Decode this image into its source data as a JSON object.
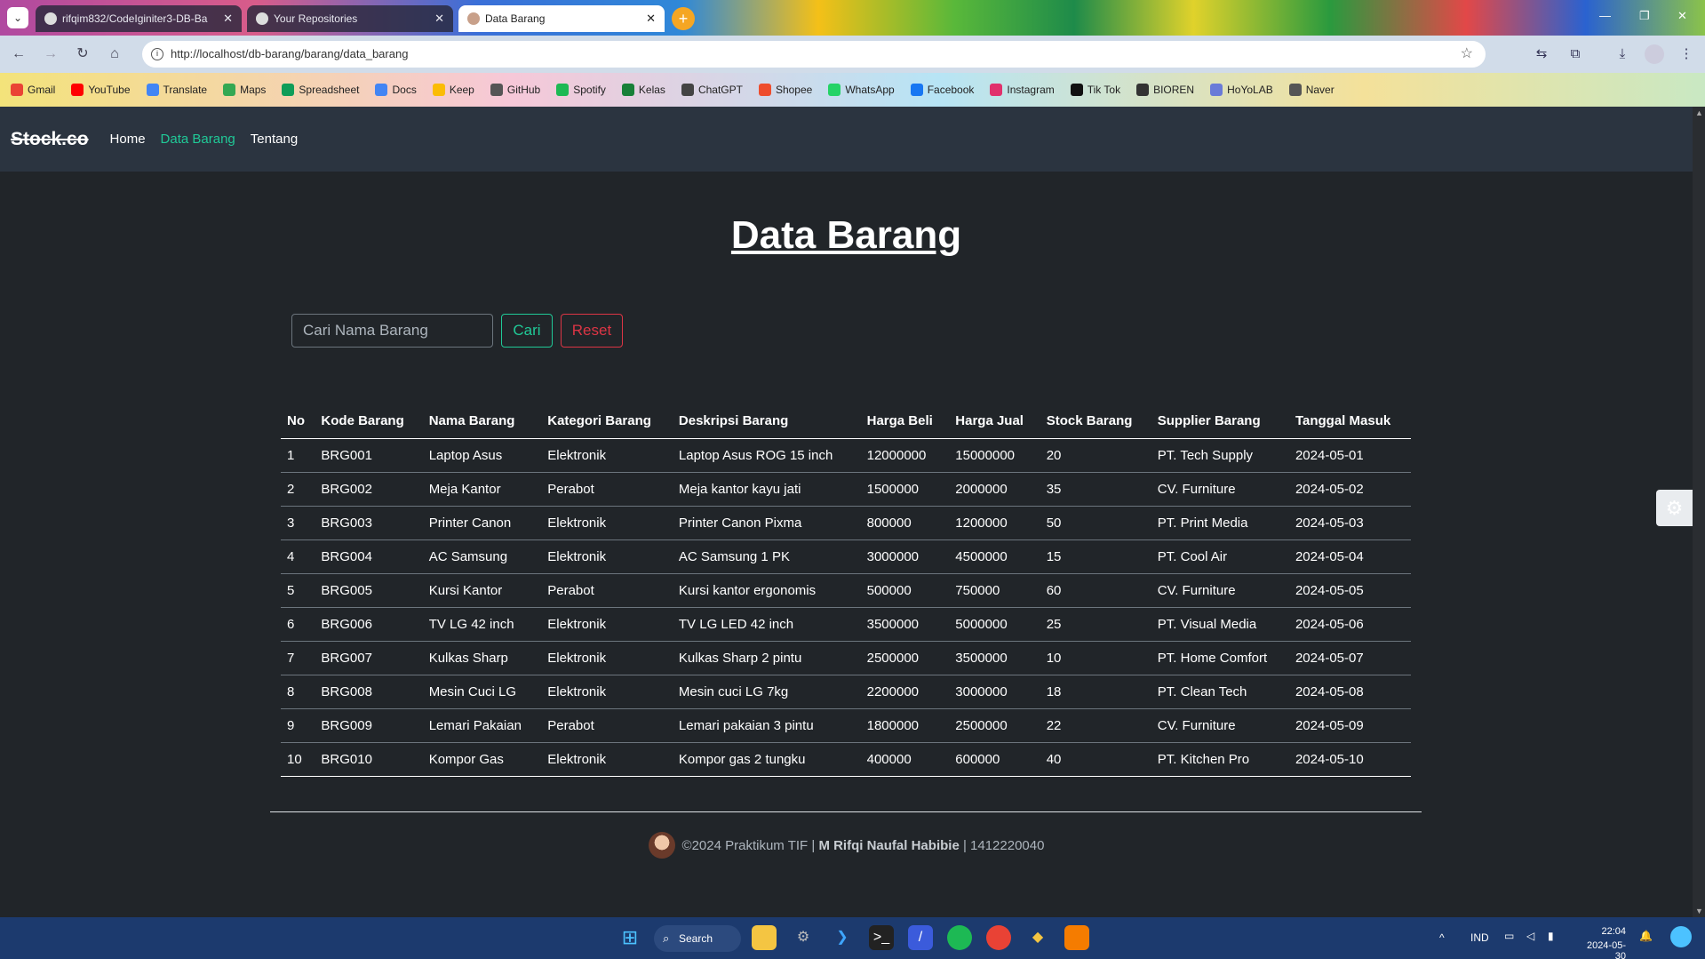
{
  "browser": {
    "tabs": [
      {
        "title": "rifqim832/CodeIginiter3-DB-Ba",
        "active": false
      },
      {
        "title": "Your Repositories",
        "active": false
      },
      {
        "title": "Data Barang",
        "active": true
      }
    ],
    "url": "http://localhost/db-barang/barang/data_barang",
    "bookmarks": [
      "Gmail",
      "YouTube",
      "Translate",
      "Maps",
      "Spreadsheet",
      "Docs",
      "Keep",
      "GitHub",
      "Spotify",
      "Kelas",
      "ChatGPT",
      "Shopee",
      "WhatsApp",
      "Facebook",
      "Instagram",
      "Tik Tok",
      "BIOREN",
      "HoYoLAB",
      "Naver"
    ],
    "bookmark_colors": [
      "#ea4335",
      "#ff0000",
      "#4285f4",
      "#34a853",
      "#0f9d58",
      "#4285f4",
      "#fbbc04",
      "#555555",
      "#1db954",
      "#188038",
      "#444444",
      "#ee4d2d",
      "#25d366",
      "#1877f2",
      "#e1306c",
      "#111111",
      "#333333",
      "#6a7bd8",
      "#555555"
    ]
  },
  "app": {
    "brand": "Stock.co",
    "nav": [
      "Home",
      "Data Barang",
      "Tentang"
    ],
    "active_nav": "Data Barang",
    "title": "Data Barang",
    "search": {
      "placeholder": "Cari Nama Barang",
      "cari_label": "Cari",
      "reset_label": "Reset"
    },
    "table": {
      "columns": [
        "No",
        "Kode Barang",
        "Nama Barang",
        "Kategori Barang",
        "Deskripsi Barang",
        "Harga Beli",
        "Harga Jual",
        "Stock Barang",
        "Supplier Barang",
        "Tanggal Masuk"
      ],
      "rows": [
        [
          "1",
          "BRG001",
          "Laptop Asus",
          "Elektronik",
          "Laptop Asus ROG 15 inch",
          "12000000",
          "15000000",
          "20",
          "PT. Tech Supply",
          "2024-05-01"
        ],
        [
          "2",
          "BRG002",
          "Meja Kantor",
          "Perabot",
          "Meja kantor kayu jati",
          "1500000",
          "2000000",
          "35",
          "CV. Furniture",
          "2024-05-02"
        ],
        [
          "3",
          "BRG003",
          "Printer Canon",
          "Elektronik",
          "Printer Canon Pixma",
          "800000",
          "1200000",
          "50",
          "PT. Print Media",
          "2024-05-03"
        ],
        [
          "4",
          "BRG004",
          "AC Samsung",
          "Elektronik",
          "AC Samsung 1 PK",
          "3000000",
          "4500000",
          "15",
          "PT. Cool Air",
          "2024-05-04"
        ],
        [
          "5",
          "BRG005",
          "Kursi Kantor",
          "Perabot",
          "Kursi kantor ergonomis",
          "500000",
          "750000",
          "60",
          "CV. Furniture",
          "2024-05-05"
        ],
        [
          "6",
          "BRG006",
          "TV LG 42 inch",
          "Elektronik",
          "TV LG LED 42 inch",
          "3500000",
          "5000000",
          "25",
          "PT. Visual Media",
          "2024-05-06"
        ],
        [
          "7",
          "BRG007",
          "Kulkas Sharp",
          "Elektronik",
          "Kulkas Sharp 2 pintu",
          "2500000",
          "3500000",
          "10",
          "PT. Home Comfort",
          "2024-05-07"
        ],
        [
          "8",
          "BRG008",
          "Mesin Cuci LG",
          "Elektronik",
          "Mesin cuci LG 7kg",
          "2200000",
          "3000000",
          "18",
          "PT. Clean Tech",
          "2024-05-08"
        ],
        [
          "9",
          "BRG009",
          "Lemari Pakaian",
          "Perabot",
          "Lemari pakaian 3 pintu",
          "1800000",
          "2500000",
          "22",
          "CV. Furniture",
          "2024-05-09"
        ],
        [
          "10",
          "BRG010",
          "Kompor Gas",
          "Elektronik",
          "Kompor gas 2 tungku",
          "400000",
          "600000",
          "40",
          "PT. Kitchen Pro",
          "2024-05-10"
        ]
      ]
    },
    "footer": {
      "prefix": "©2024 Praktikum TIF |",
      "author": "M Rifqi Naufal Habibie",
      "suffix": "| 1412220040"
    }
  },
  "taskbar": {
    "search_label": "Search",
    "language": "IND",
    "time": "22:04",
    "date": "2024-05-30"
  },
  "colors": {
    "accent": "#20c997",
    "danger": "#dc3545",
    "navbar": "#2b3440",
    "background": "#212529"
  }
}
